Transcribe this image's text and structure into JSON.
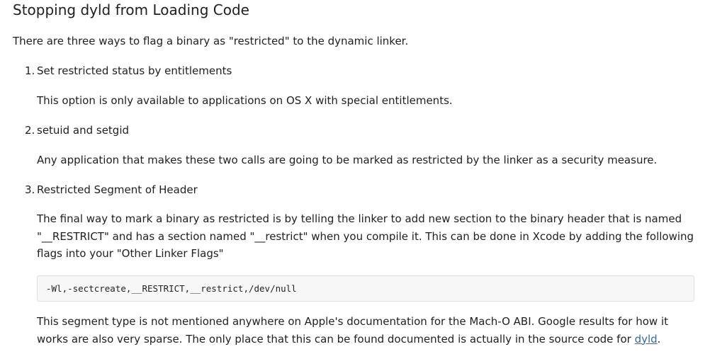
{
  "article": {
    "title": "Stopping dyld from Loading Code",
    "intro": "There are three ways to flag a binary as \"restricted\" to the dynamic linker.",
    "items": [
      {
        "number": "1.",
        "title": "Set restricted status by entitlements",
        "body": "This option is only available to applications on OS X with special entitlements."
      },
      {
        "number": "2.",
        "title": "setuid and setgid",
        "body": "Any application that makes these two calls are going to be marked as restricted by the linker as a security measure."
      },
      {
        "number": "3.",
        "title": "Restricted Segment of Header",
        "body_lines": [
          "The final way to mark a binary as restricted is by telling the linker to add new section to the binary header that is named",
          "\"__RESTRICT\" and has a section named \"__restrict\" when you compile it. This can be done in Xcode by adding the following",
          "flags into your \"Other Linker Flags\""
        ]
      }
    ],
    "code": "-Wl,-sectcreate,__RESTRICT,__restrict,/dev/null",
    "closing_lines": [
      "This segment type is not mentioned anywhere on Apple's documentation for the Mach-O ABI. Google results for how it",
      "works are also very sparse. The only place that this can be found documented is actually in the source code for "
    ],
    "closing_link": "dyld",
    "closing_end": "."
  }
}
